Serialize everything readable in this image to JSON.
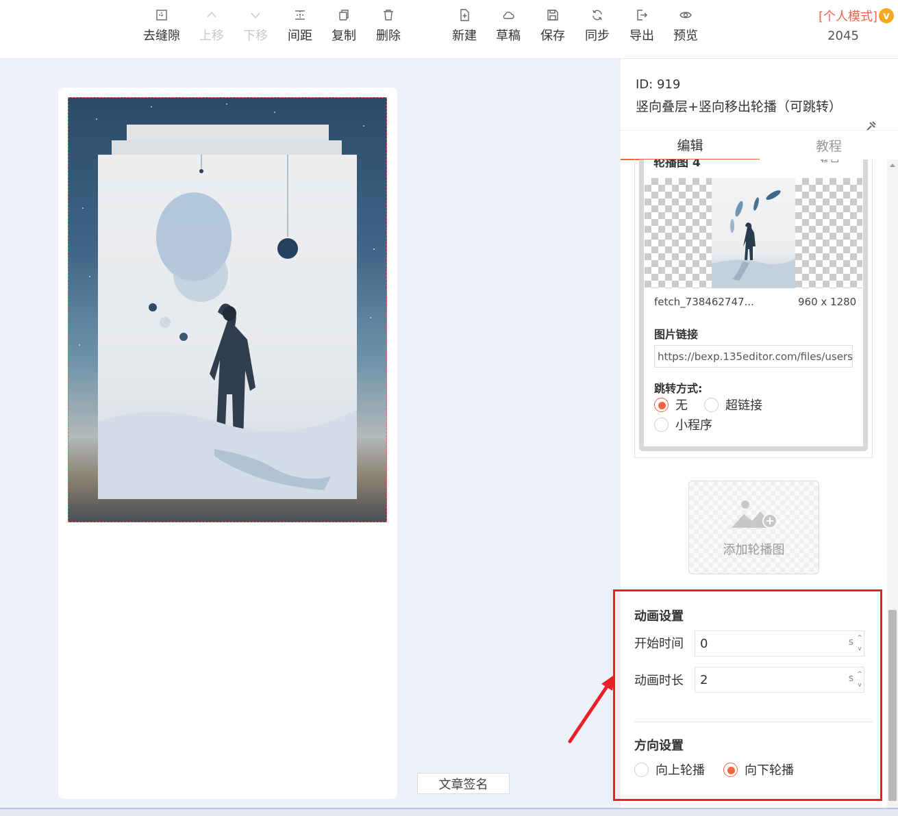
{
  "toolbar": {
    "left_buttons": [
      {
        "label": "去缝隙",
        "icon": "gap-icon",
        "disabled": false
      },
      {
        "label": "上移",
        "icon": "chevron-up-icon",
        "disabled": true
      },
      {
        "label": "下移",
        "icon": "chevron-down-icon",
        "disabled": true
      },
      {
        "label": "间距",
        "icon": "spacing-icon",
        "disabled": false
      },
      {
        "label": "复制",
        "icon": "copy-icon",
        "disabled": false
      },
      {
        "label": "删除",
        "icon": "trash-icon",
        "disabled": false
      }
    ],
    "right_buttons": [
      {
        "label": "新建",
        "icon": "new-file-icon"
      },
      {
        "label": "草稿",
        "icon": "cloud-icon"
      },
      {
        "label": "保存",
        "icon": "save-icon"
      },
      {
        "label": "同步",
        "icon": "sync-icon"
      },
      {
        "label": "导出",
        "icon": "export-icon"
      },
      {
        "label": "预览",
        "icon": "eye-icon"
      }
    ],
    "mode_label": "[个人模式]",
    "mode_badge": "v",
    "mode_number": "2045"
  },
  "editor": {
    "signature_button": "文章签名"
  },
  "panel": {
    "id_text": "ID: 919",
    "title": "竖向叠层+竖向移出轮播（可跳转）",
    "tabs": [
      {
        "label": "编辑",
        "active": true
      },
      {
        "label": "教程",
        "active": false
      }
    ],
    "slide": {
      "header": "轮播图 4",
      "file_name": "fetch_738462747...",
      "file_size": "960 x 1280",
      "link_label": "图片链接",
      "link_value": "https://bexp.135editor.com/files/users/0/",
      "jump_label": "跳转方式:",
      "jump_options": [
        {
          "label": "无",
          "selected": true
        },
        {
          "label": "超链接",
          "selected": false
        },
        {
          "label": "小程序",
          "selected": false
        }
      ]
    },
    "add_slide_label": "添加轮播图",
    "animation": {
      "section_title": "动画设置",
      "start_label": "开始时间",
      "start_value": "0",
      "duration_label": "动画时长",
      "duration_value": "2",
      "unit": "s"
    },
    "direction": {
      "section_title": "方向设置",
      "options": [
        {
          "label": "向上轮播",
          "selected": false
        },
        {
          "label": "向下轮播",
          "selected": true
        }
      ]
    }
  },
  "colors": {
    "accent": "#f06543",
    "annotation_red": "#e8202a",
    "badge": "#f2a91e"
  }
}
